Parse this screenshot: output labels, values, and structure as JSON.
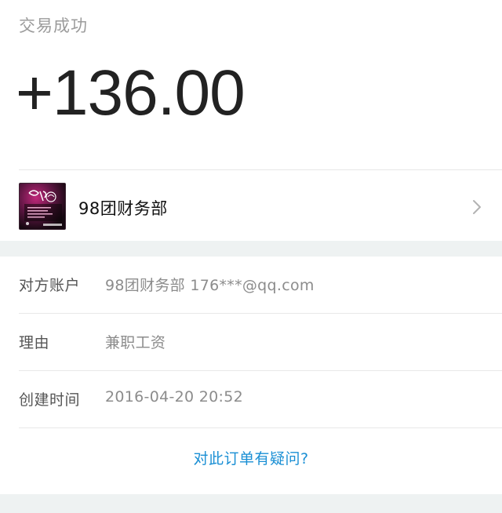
{
  "header": {
    "status": "交易成功",
    "amount": "+136.00"
  },
  "payee": {
    "avatar_icon": "merchant-avatar-icon",
    "name": "98团财务部",
    "chevron_icon": "chevron-right-icon"
  },
  "details": {
    "rows": [
      {
        "label": "对方账户",
        "value": "98团财务部 176***@qq.com"
      },
      {
        "label": "理由",
        "value": "兼职工资"
      },
      {
        "label": "创建时间",
        "value": "2016-04-20 20:52"
      }
    ]
  },
  "footer": {
    "question_link": "对此订单有疑问?"
  },
  "colors": {
    "link": "#1a8fd4",
    "band": "#eef2f2",
    "amount_text": "#222222"
  }
}
